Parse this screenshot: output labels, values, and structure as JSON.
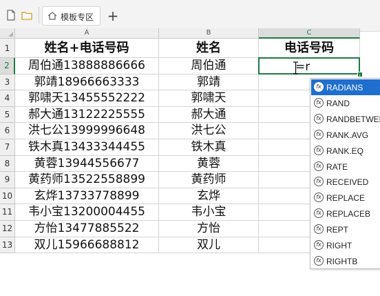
{
  "tabbar": {
    "tab_label": "模板专区",
    "add_label": "+"
  },
  "columns": [
    {
      "letter": "A"
    },
    {
      "letter": "B"
    },
    {
      "letter": "C"
    }
  ],
  "rows": [
    {
      "num": "1",
      "a": "姓名+电话号码",
      "b": "姓名",
      "c": "电话号码"
    },
    {
      "num": "2",
      "a": "周伯通13888886666",
      "b": "周伯通",
      "c": ""
    },
    {
      "num": "3",
      "a": "郭靖18966663333",
      "b": "郭靖",
      "c": ""
    },
    {
      "num": "4",
      "a": "郭啸天13455552222",
      "b": "郭啸天",
      "c": ""
    },
    {
      "num": "5",
      "a": "郝大通13122225555",
      "b": "郝大通",
      "c": ""
    },
    {
      "num": "6",
      "a": "洪七公13999996648",
      "b": "洪七公",
      "c": ""
    },
    {
      "num": "7",
      "a": "铁木真13433344455",
      "b": "铁木真",
      "c": ""
    },
    {
      "num": "8",
      "a": "黄蓉13944556677",
      "b": "黄蓉",
      "c": ""
    },
    {
      "num": "9",
      "a": "黄药师13522558899",
      "b": "黄药师",
      "c": ""
    },
    {
      "num": "10",
      "a": "玄烨13733778899",
      "b": "玄烨",
      "c": ""
    },
    {
      "num": "11",
      "a": "韦小宝13200004455",
      "b": "韦小宝",
      "c": ""
    },
    {
      "num": "12",
      "a": "方怡13477885522",
      "b": "方怡",
      "c": ""
    },
    {
      "num": "13",
      "a": "双儿15966688812",
      "b": "双儿",
      "c": ""
    }
  ],
  "active_cell": {
    "formula": "=r"
  },
  "autocomplete": {
    "items": [
      "RADIANS",
      "RAND",
      "RANDBETWEEN",
      "RANK.AVG",
      "RANK.EQ",
      "RATE",
      "RECEIVED",
      "REPLACE",
      "REPLACEB",
      "REPT",
      "RIGHT",
      "RIGHTB"
    ],
    "selected": "RADIANS",
    "fx_glyph": "fx"
  },
  "colors": {
    "accent": "#1f7a43",
    "selection_blue": "#1f6fce"
  }
}
